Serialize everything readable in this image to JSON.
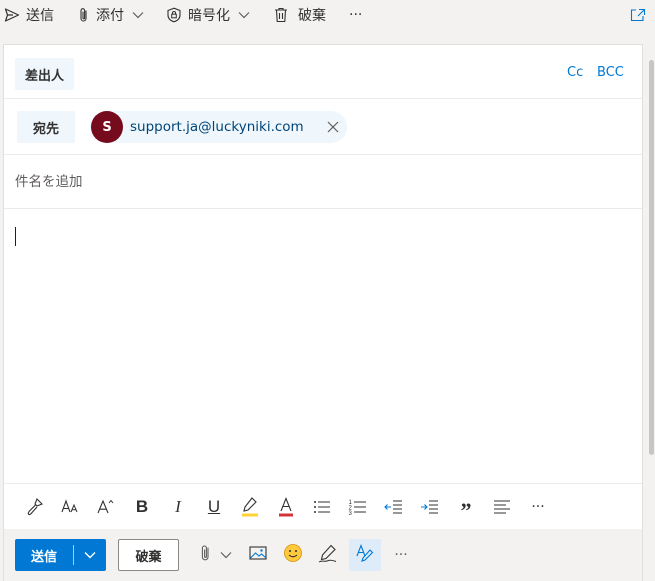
{
  "toolbar": {
    "send_label": "送信",
    "attach_label": "添付",
    "encrypt_label": "暗号化",
    "discard_label": "破棄",
    "more_label": "···"
  },
  "header": {
    "from_label": "差出人",
    "cc_label": "Cc",
    "bcc_label": "BCC",
    "to_label": "宛先",
    "recipient": {
      "initial": "S",
      "email": "support.ja@luckyniki.com",
      "avatar_color": "#750b1c"
    },
    "subject_placeholder": "件名を追加"
  },
  "format_toolbar": {
    "icons": [
      "format-painter-icon",
      "font-size-icon",
      "grow-font-icon",
      "bold-icon",
      "italic-icon",
      "underline-icon",
      "highlight-icon",
      "font-color-icon",
      "bullets-icon",
      "numbering-icon",
      "decrease-indent-icon",
      "increase-indent-icon",
      "quote-icon",
      "align-icon",
      "more-icon"
    ],
    "bold_glyph": "B",
    "italic_glyph": "I",
    "underline_glyph": "U",
    "quote_glyph": "”",
    "more_glyph": "···"
  },
  "actions": {
    "send_label": "送信",
    "discard_label": "破棄",
    "more_label": "···"
  },
  "colors": {
    "accent": "#0078d4",
    "chip_bg": "#eff6fc",
    "highlight": "#ffd335",
    "font_color": "#d13438"
  }
}
